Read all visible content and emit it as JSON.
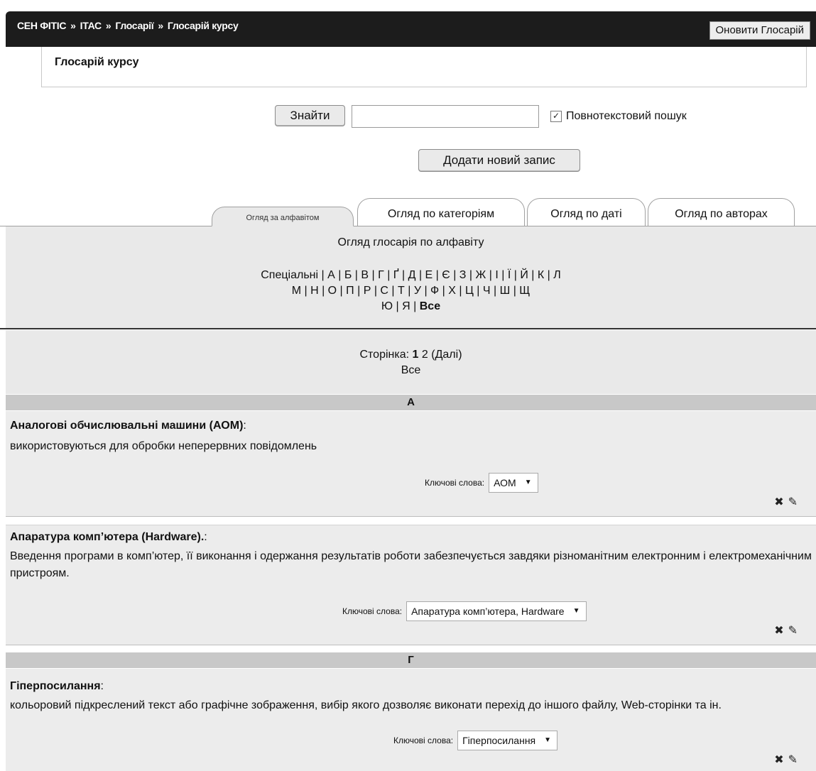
{
  "breadcrumb": [
    "СЕН ФІТІС",
    "ІТАС",
    "Глосарії",
    "Глосарій курсу"
  ],
  "breadcrumb_sep": "»",
  "update_button": "Оновити Глосарій",
  "heading": "Глосарій курсу",
  "search": {
    "button": "Знайти",
    "value": "",
    "fulltext_label": "Повнотекстовий пошук",
    "fulltext_checked": true
  },
  "add_button": "Додати новий запис",
  "tabs": [
    "Огляд за алфавітом",
    "Огляд по категоріям",
    "Огляд по даті",
    "Огляд по авторах"
  ],
  "browse_title": "Огляд глосарія по алфавіту",
  "letters_line1": "Спеціальні | А | Б | В | Г | Ґ | Д | Е | Є | З | Ж | І | Ї | Й | К | Л",
  "letters_line2": "М | Н | О | П | Р | С | Т | У | Ф | Х | Ц | Ч | Ш | Щ",
  "letters_line3_prefix": "Ю | Я |",
  "letters_all": "Все",
  "paging": {
    "label": "Сторінка:",
    "current": "1",
    "other": "2",
    "next": "(Далі)",
    "all": "Все"
  },
  "keywords_label": "Ключові слова:",
  "sections": [
    {
      "letter": "А",
      "entries": [
        {
          "term": "Аналогові обчислювальні машини (АОМ)",
          "suffix": ":",
          "definition": "використовуються для обробки неперервних повідомлень",
          "keyword": "АОМ"
        },
        {
          "term": "Апаратура комп’ютера (Hardware).",
          "suffix": ":",
          "definition": "Введення програми в комп’ютер, її виконання і одержання результатів роботи забезпечується завдяки різноманітним електронним і  електромеханічним пристроям.",
          "keyword": "Апаратура комп’ютера, Hardware"
        }
      ]
    },
    {
      "letter": "Г",
      "entries": [
        {
          "term": "Гіперпосилання",
          "suffix": ":",
          "definition": "кольоровий підкреслений текст або графічне зображення, вибір якого дозволяє виконати перехід до іншого файлу, Web-сторінки та ін.",
          "keyword": "Гіперпосилання"
        }
      ]
    }
  ],
  "icons": {
    "delete": "delete-icon",
    "edit": "edit-icon"
  }
}
